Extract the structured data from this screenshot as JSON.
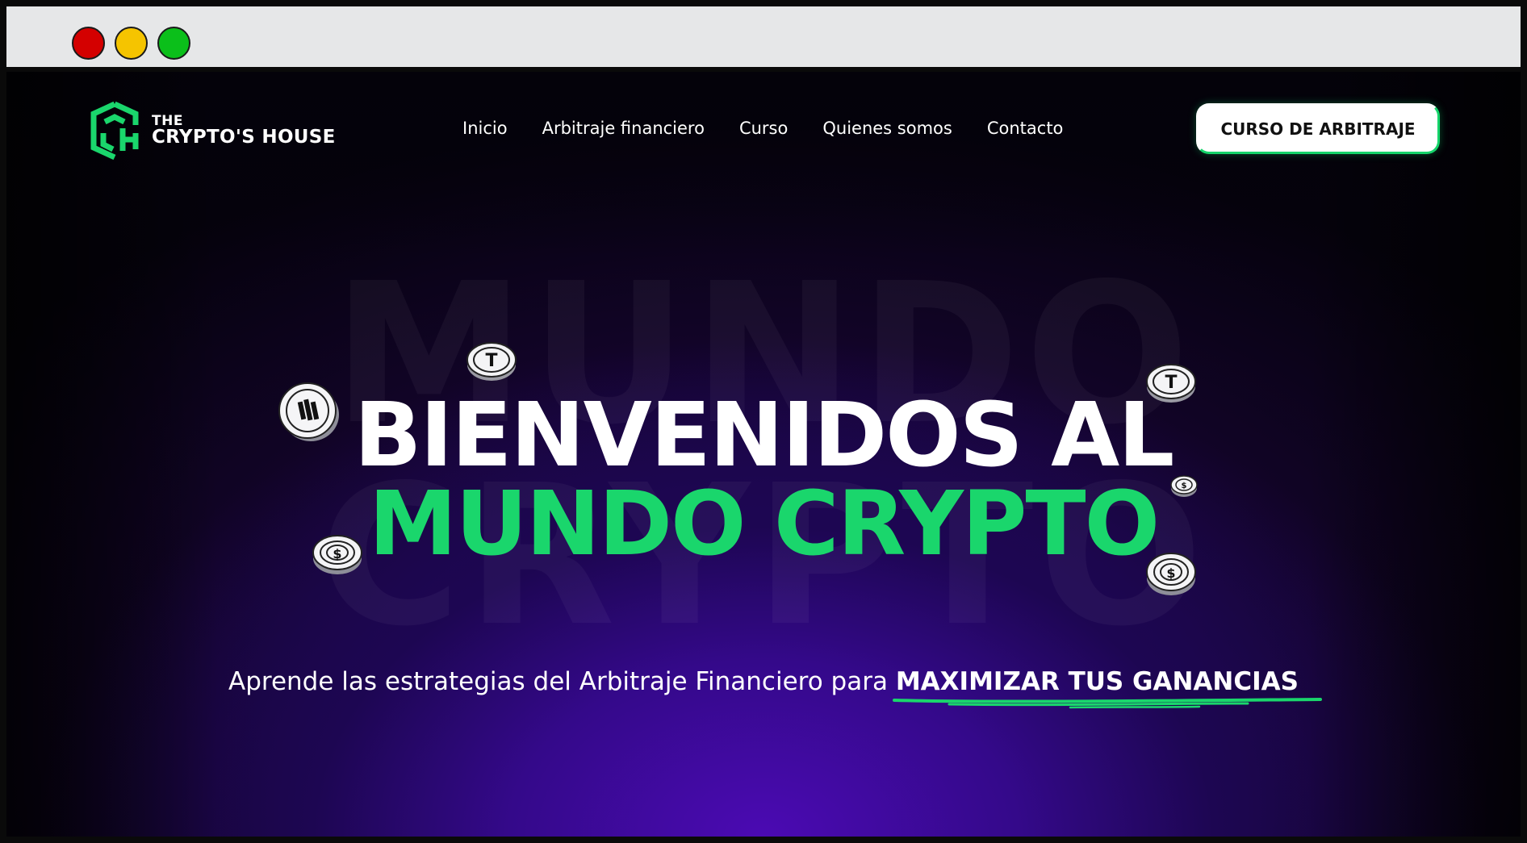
{
  "browser": {
    "controls": [
      "close",
      "minimize",
      "maximize"
    ]
  },
  "brand": {
    "line1": "THE",
    "line2": "CRYPTO'S HOUSE",
    "accent_color": "#1ad66c"
  },
  "nav": {
    "items": [
      {
        "label": "Inicio"
      },
      {
        "label": "Arbitraje financiero"
      },
      {
        "label": "Curso"
      },
      {
        "label": "Quienes somos"
      },
      {
        "label": "Contacto"
      }
    ],
    "cta_label": "CURSO DE ARBITRAJE"
  },
  "hero": {
    "background_word_1": "MUNDO",
    "background_word_2": "CRYPTO",
    "headline_line1": "BIENVENIDOS AL",
    "headline_line2": "MUNDO CRYPTO",
    "subtitle_plain": "Aprende las estrategias del Arbitraje Financiero para ",
    "subtitle_emphasis": "MAXIMIZAR TUS GANANCIAS"
  },
  "coins": [
    {
      "symbol": "T",
      "name": "tether-coin"
    },
    {
      "symbol": "T",
      "name": "tether-coin"
    },
    {
      "symbol": "binance",
      "name": "binance-coin"
    },
    {
      "symbol": "$",
      "name": "usd-coin"
    },
    {
      "symbol": "$",
      "name": "usd-coin"
    },
    {
      "symbol": "$",
      "name": "usd-coin"
    }
  ]
}
